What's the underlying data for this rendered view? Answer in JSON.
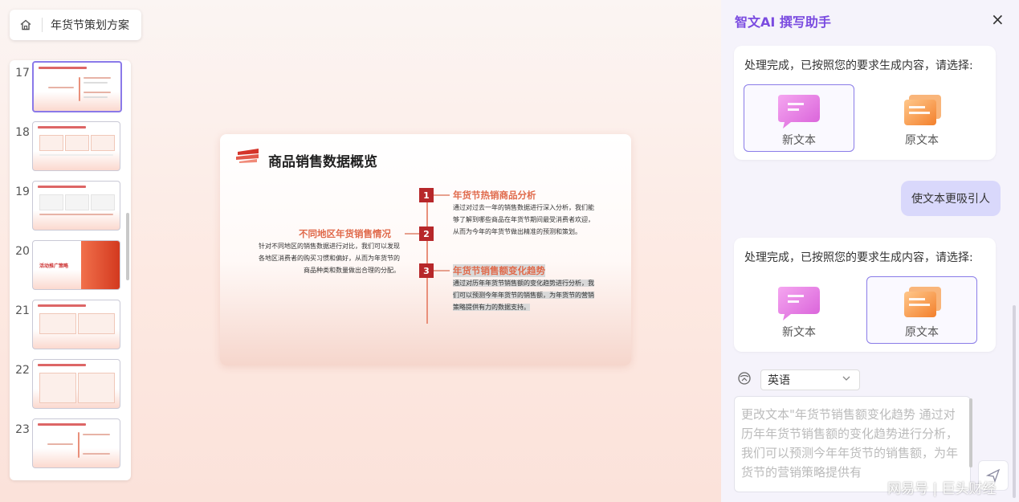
{
  "breadcrumb": {
    "title": "年货节策划方案"
  },
  "thumbnails": [
    {
      "number": "17",
      "active": true
    },
    {
      "number": "18"
    },
    {
      "number": "19"
    },
    {
      "number": "20",
      "label": "活动推广策略"
    },
    {
      "number": "21"
    },
    {
      "number": "22"
    },
    {
      "number": "23"
    }
  ],
  "slide": {
    "title": "商品销售数据概览",
    "sections": [
      {
        "num": "1",
        "title": "年货节热销商品分析",
        "body": "通过对过去一年的销售数据进行深入分析，我们能够了解到哪些商品在年货节期间最受消费者欢迎，从而为今年的年货节做出精准的预测和策划。"
      },
      {
        "num": "2",
        "title": "不同地区年货销售情况",
        "body": "针对不同地区的销售数据进行对比，我们可以发现各地区消费者的购买习惯和偏好，从而为年货节的商品种类和数量做出合理的分配。"
      },
      {
        "num": "3",
        "title": "年货节销售额变化趋势",
        "body": "通过对历年年货节销售额的变化趋势进行分析，我们可以预测今年年货节的销售额，为年货节的营销策略提供有力的数据支持。"
      }
    ]
  },
  "assistant": {
    "title": "智文AI 撰写助手",
    "close_icon": "×",
    "messages": [
      {
        "text": "处理完成，已按照您的要求生成内容，请选择:",
        "options": [
          "新文本",
          "原文本"
        ],
        "selected": 0
      },
      {
        "user": "使文本更吸引人"
      },
      {
        "text": "处理完成，已按照您的要求生成内容，请选择:",
        "options": [
          "新文本",
          "原文本"
        ],
        "selected": 1
      }
    ],
    "language": "英语",
    "input_text": "更改文本\"年货节销售额变化趋势 通过对历年年货节销售额的变化趋势进行分析，我们可以预测今年年货节的销售额，为年货节的营销策略提供有"
  },
  "watermark": "网易号 | 巨头财经"
}
